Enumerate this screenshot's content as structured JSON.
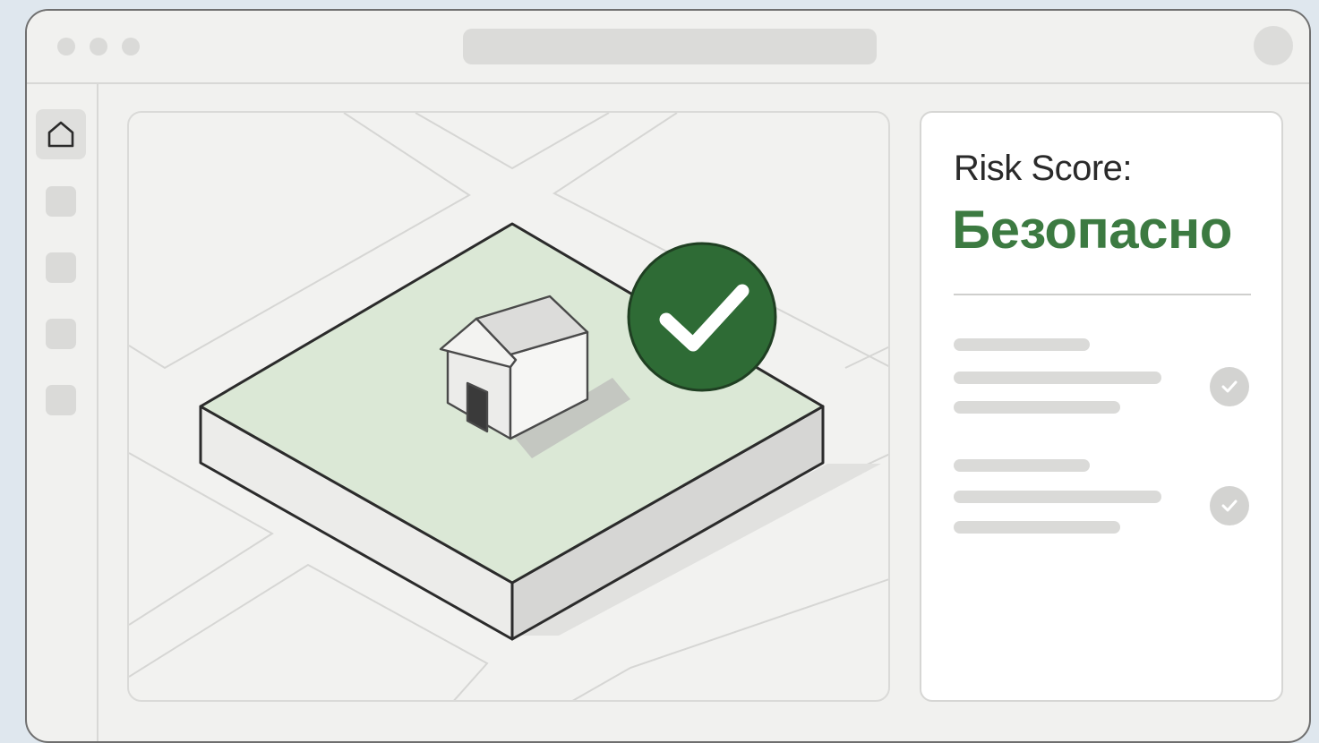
{
  "risk_panel": {
    "label": "Risk Score:",
    "value": "Безопасно",
    "value_color": "#3c7a41"
  },
  "map": {
    "status_badge_color": "#2e6b35",
    "parcel_color": "#dbe8d6"
  },
  "icons": [
    "home-icon",
    "check-icon",
    "house-icon"
  ]
}
